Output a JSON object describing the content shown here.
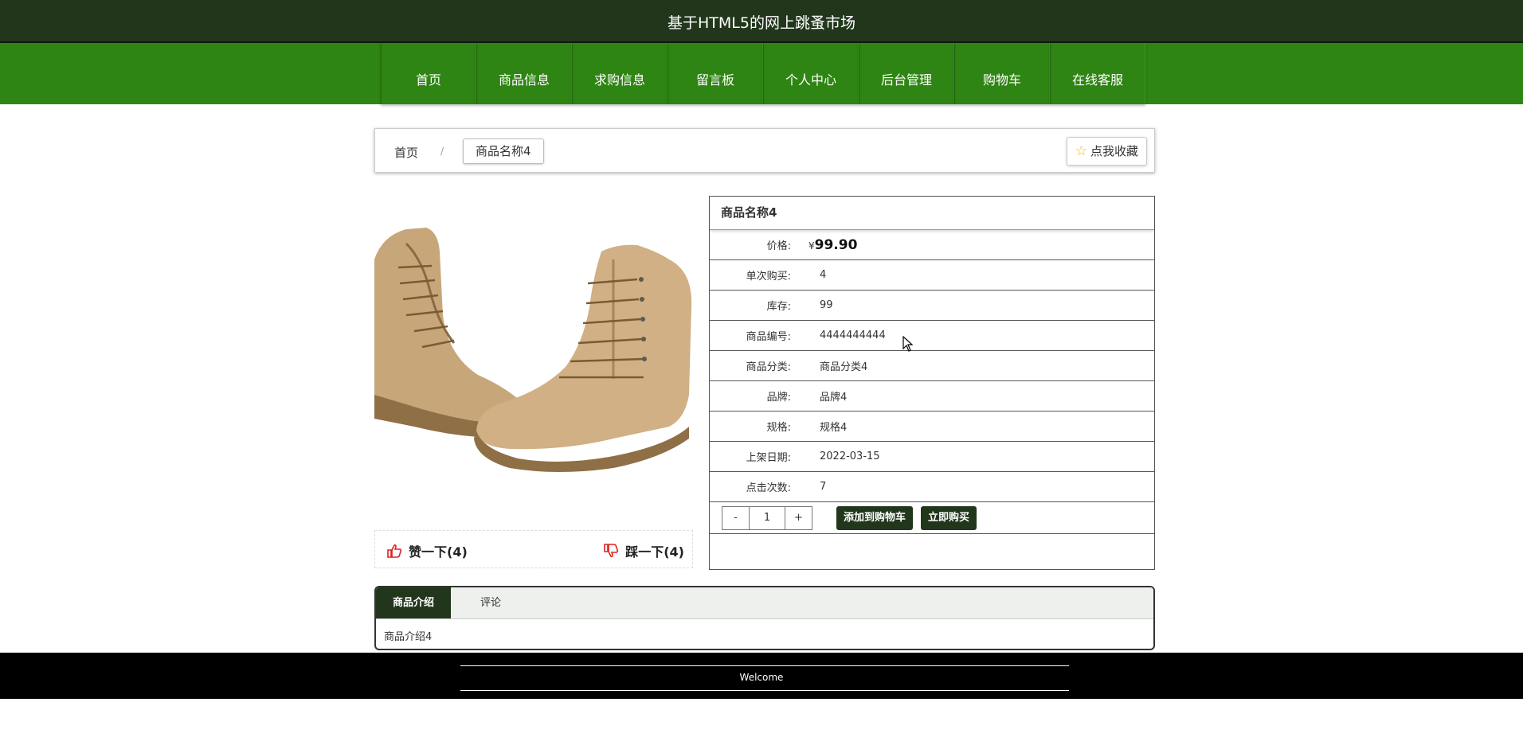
{
  "header": {
    "title": "基于HTML5的网上跳蚤市场"
  },
  "nav": {
    "items": [
      "首页",
      "商品信息",
      "求购信息",
      "留言板",
      "个人中心",
      "后台管理",
      "购物车",
      "在线客服"
    ]
  },
  "breadcrumb": {
    "home": "首页",
    "separator": "/",
    "current": "商品名称4"
  },
  "favorite": {
    "label": "点我收藏",
    "icon": "star-icon"
  },
  "vote": {
    "like_label": "赞一下(4)",
    "dislike_label": "踩一下(4)"
  },
  "product": {
    "name": "商品名称4",
    "price_label": "价格:",
    "currency": "¥",
    "price": "99.90",
    "rows": [
      {
        "label": "单次购买:",
        "value": "4"
      },
      {
        "label": "库存:",
        "value": "99"
      },
      {
        "label": "商品编号:",
        "value": "4444444444"
      },
      {
        "label": "商品分类:",
        "value": "商品分类4"
      },
      {
        "label": "品牌:",
        "value": "品牌4"
      },
      {
        "label": "规格:",
        "value": "规格4"
      },
      {
        "label": "上架日期:",
        "value": "2022-03-15"
      },
      {
        "label": "点击次数:",
        "value": "7"
      }
    ]
  },
  "buy": {
    "minus": "-",
    "quantity": "1",
    "plus": "+",
    "add_to_cart": "添加到购物车",
    "buy_now": "立即购买"
  },
  "tabs": {
    "intro_tab": "商品介绍",
    "comment_tab": "评论",
    "content": "商品介绍4"
  },
  "footer": {
    "text": "Welcome"
  },
  "colors": {
    "header_bg": "#21361b",
    "nav_bg": "#2f8513",
    "accent": "#21361b",
    "footer_bg": "#000000"
  }
}
